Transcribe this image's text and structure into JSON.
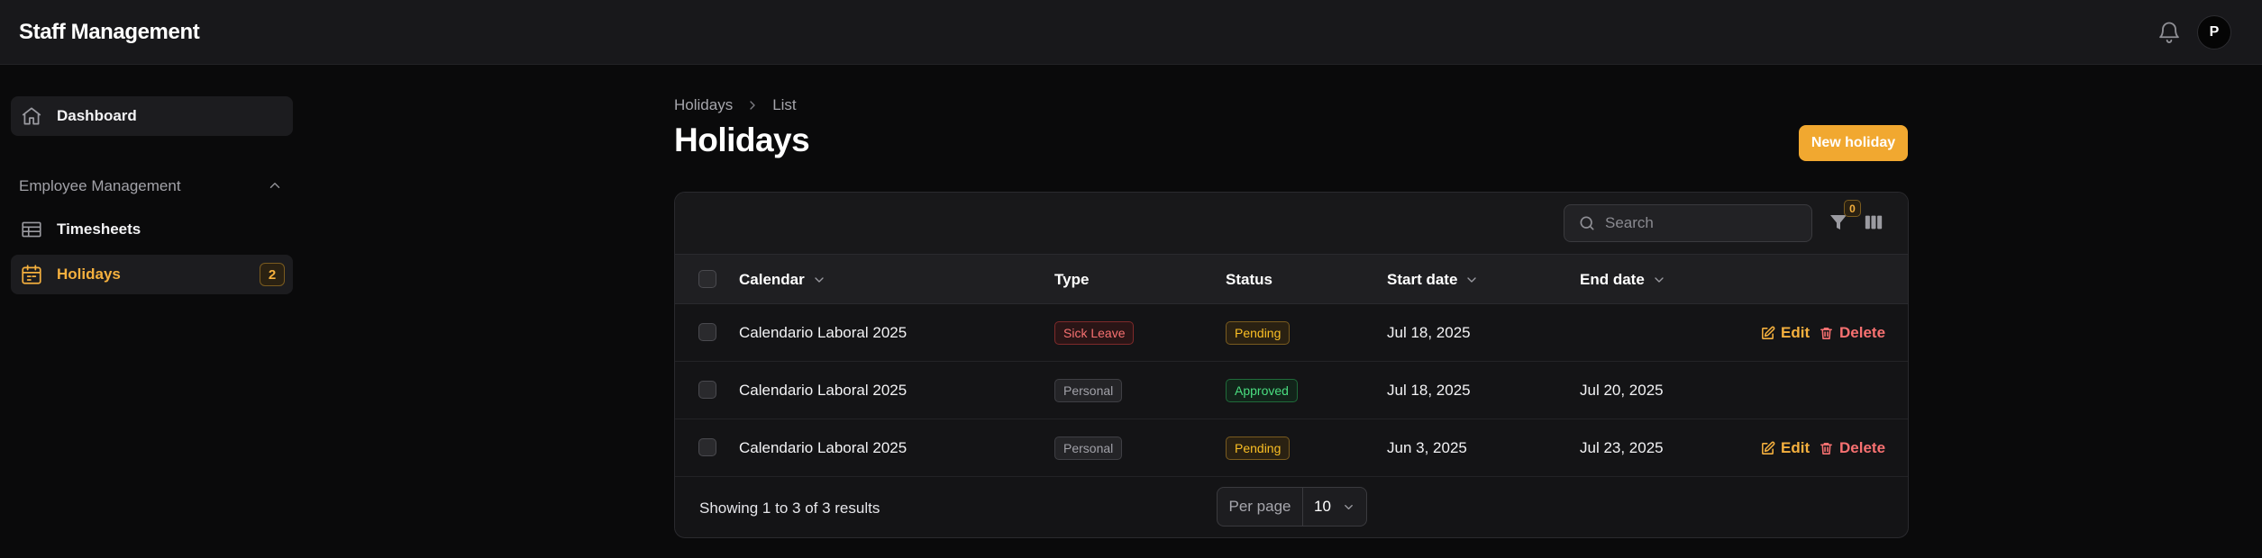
{
  "app": {
    "title": "Staff Management",
    "avatar_initial": "P"
  },
  "sidebar": {
    "dashboard": "Dashboard",
    "group_label": "Employee Management",
    "timesheets": "Timesheets",
    "holidays": "Holidays",
    "holidays_count": "2"
  },
  "breadcrumb": {
    "parent": "Holidays",
    "current": "List"
  },
  "page": {
    "title": "Holidays",
    "new_button": "New holiday"
  },
  "toolbar": {
    "search_placeholder": "Search",
    "filter_count": "0"
  },
  "table": {
    "columns": {
      "calendar": "Calendar",
      "type": "Type",
      "status": "Status",
      "start": "Start date",
      "end": "End date"
    },
    "rows": [
      {
        "calendar": "Calendario Laboral 2025",
        "type": "Sick Leave",
        "status": "Pending",
        "start": "Jul 18, 2025",
        "end": "",
        "edit": "Edit",
        "delete": "Delete"
      },
      {
        "calendar": "Calendario Laboral 2025",
        "type": "Personal",
        "status": "Approved",
        "start": "Jul 18, 2025",
        "end": "Jul 20, 2025"
      },
      {
        "calendar": "Calendario Laboral 2025",
        "type": "Personal",
        "status": "Pending",
        "start": "Jun 3, 2025",
        "end": "Jul 23, 2025",
        "edit": "Edit",
        "delete": "Delete"
      }
    ]
  },
  "footer": {
    "results": "Showing 1 to 3 of 3 results",
    "per_page_label": "Per page",
    "per_page_value": "10"
  },
  "colors": {
    "accent": "#f1a830",
    "danger": "#f87171",
    "success": "#4ade80"
  }
}
